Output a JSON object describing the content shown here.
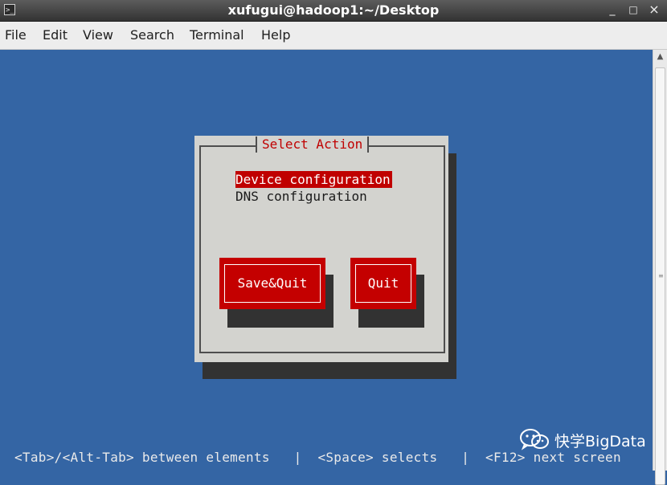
{
  "window": {
    "title": "xufugui@hadoop1:~/Desktop",
    "app_icon": "terminal-icon",
    "controls": {
      "minimize": "_",
      "maximize": "□",
      "close": "×"
    }
  },
  "menubar": {
    "items": [
      "File",
      "Edit",
      "View",
      "Search",
      "Terminal",
      "Help"
    ]
  },
  "dialog": {
    "title": "Select Action",
    "options": [
      {
        "label": "Device configuration",
        "selected": true
      },
      {
        "label": "DNS configuration",
        "selected": false
      }
    ],
    "buttons": {
      "save_quit": "Save&Quit",
      "quit": "Quit"
    }
  },
  "statusbar": {
    "text": "<Tab>/<Alt-Tab> between elements   |  <Space> selects   |  <F12> next screen"
  },
  "watermark": {
    "text": "快学BigData",
    "icon": "wechat-icon"
  },
  "colors": {
    "terminal_bg": "#3465a4",
    "dialog_bg": "#d3d3cf",
    "accent_red": "#c40000",
    "shadow": "#323232"
  }
}
